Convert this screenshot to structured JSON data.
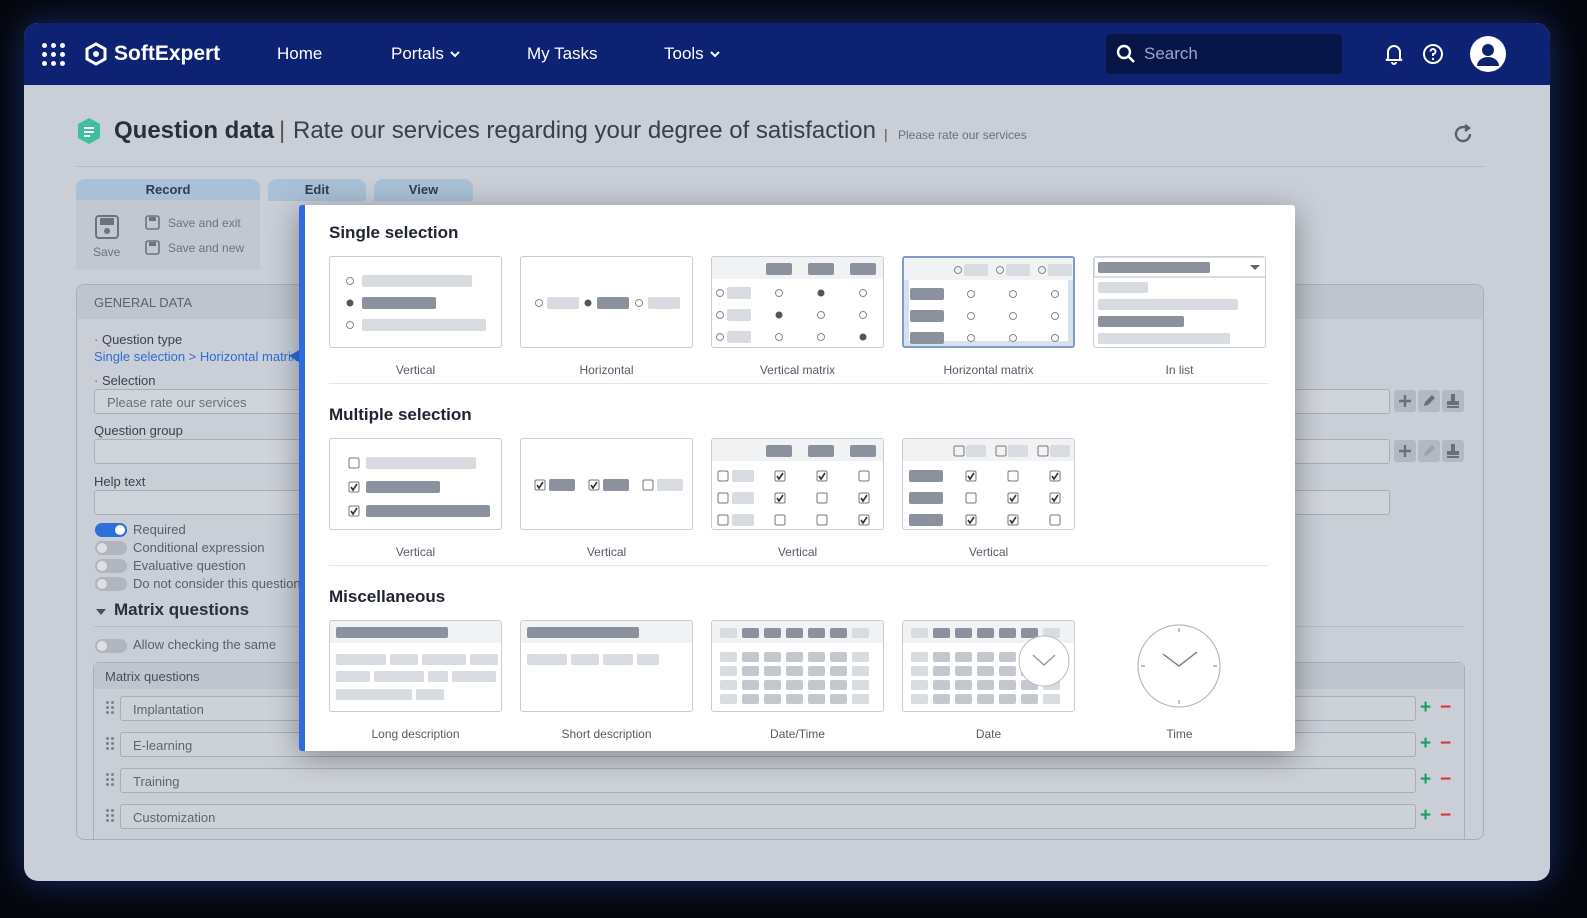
{
  "nav": {
    "brand": "SoftExpert",
    "items": [
      {
        "label": "Home"
      },
      {
        "label": "Portals"
      },
      {
        "label": "My Tasks"
      },
      {
        "label": "Tools"
      }
    ],
    "search_placeholder": "Search"
  },
  "page": {
    "title": "Question data",
    "separator": "|",
    "subtitle": "Rate our services regarding your degree of satisfaction",
    "hint": "Please rate our services"
  },
  "toolbar": {
    "tabs": [
      "Record",
      "Edit",
      "View"
    ],
    "save": "Save",
    "save_exit": "Save and exit",
    "save_new": "Save and new"
  },
  "general": {
    "header": "GENERAL DATA",
    "question_type_label": "Question type",
    "question_type_value": "Single selection > Horizontal matrix",
    "selection_label": "Selection",
    "selection_value": "Please rate our services",
    "group_label": "Question group",
    "group_value": "",
    "help_label": "Help text",
    "help_value": "",
    "toggles": [
      {
        "label": "Required",
        "on": true
      },
      {
        "label": "Conditional expression",
        "on": false
      },
      {
        "label": "Evaluative question",
        "on": false
      },
      {
        "label": "Do not consider this question",
        "on": false
      }
    ]
  },
  "matrix": {
    "title": "Matrix questions",
    "allow_label": "Allow checking the same",
    "list_header": "Matrix questions",
    "rows": [
      "Implantation",
      "E-learning",
      "Training",
      "Customization"
    ]
  },
  "modal": {
    "sections": [
      {
        "title": "Single selection",
        "options": [
          "Vertical",
          "Horizontal",
          "Vertical matrix",
          "Horizontal matrix",
          "In list"
        ],
        "selected": "Horizontal matrix"
      },
      {
        "title": "Multiple selection",
        "options": [
          "Vertical",
          "Vertical",
          "Vertical",
          "Vertical"
        ]
      },
      {
        "title": "Miscellaneous",
        "options": [
          "Long description",
          "Short description",
          "Date/Time",
          "Date",
          "Time"
        ]
      }
    ]
  },
  "colors": {
    "nav": "#0d2273",
    "accent": "#2e6be0",
    "toggle_on": "#2f6fd8",
    "plus": "#1e9b5e",
    "minus": "#d33a3a",
    "placeholder_bar": "#8b929d",
    "placeholder_light": "#d8dbe0"
  }
}
